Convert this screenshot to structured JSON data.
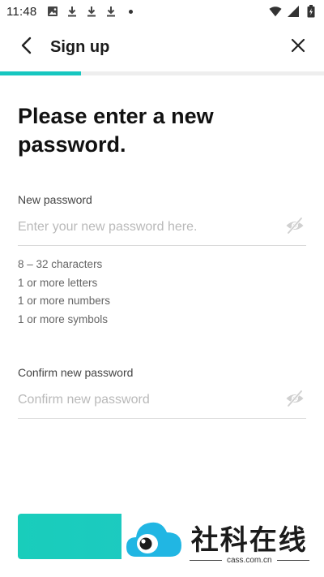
{
  "status_bar": {
    "time": "11:48",
    "left_icons": [
      "image-icon",
      "download-icon",
      "download-icon",
      "download-icon",
      "dot-icon"
    ],
    "right_icons": [
      "wifi-icon",
      "signal-icon",
      "battery-icon"
    ]
  },
  "header": {
    "title": "Sign up",
    "back_icon": "back-arrow-icon",
    "close_icon": "close-icon"
  },
  "progress": {
    "value": 0.25,
    "color": "#17c7c0"
  },
  "main": {
    "heading": "Please enter a new password.",
    "new_password": {
      "label": "New password",
      "placeholder": "Enter your new password here.",
      "value": ""
    },
    "requirements": [
      "8 – 32 characters",
      "1 or more letters",
      "1 or more numbers",
      "1 or more symbols"
    ],
    "confirm_password": {
      "label": "Confirm new password",
      "placeholder": "Confirm new password",
      "value": ""
    }
  },
  "submit": {
    "label": "",
    "color": "#19cdbb"
  },
  "watermark": {
    "title": "社科在线",
    "subtitle": "cass.com.cn"
  }
}
